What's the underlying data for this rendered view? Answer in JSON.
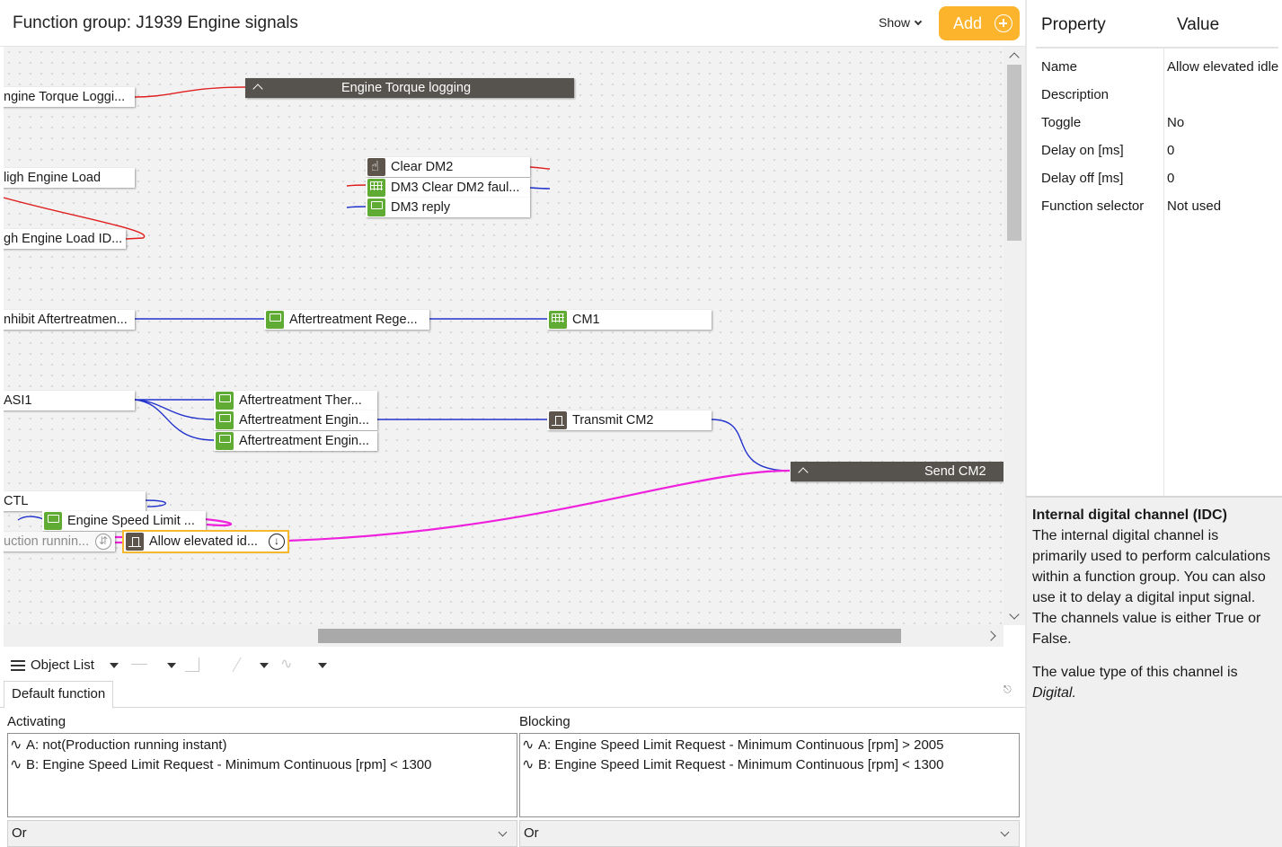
{
  "header": {
    "title": "Function group: J1939 Engine signals",
    "show_label": "Show",
    "add_label": "Add"
  },
  "canvas": {
    "groups": {
      "engine_torque": "Engine Torque logging",
      "send_cm2": "Send CM2"
    },
    "nodes": {
      "engine_torque_logging": "ngine Torque Loggi...",
      "high_engine_load": "ligh Engine Load",
      "high_engine_load_id": "gh Engine Load ID...",
      "clear_dm2": "Clear DM2",
      "dm3_clear_dm2_faul": "DM3 Clear DM2 faul...",
      "dm3_reply": "DM3 reply",
      "inhibit_aftertreatment": "nhibit Aftertreatmen...",
      "aftertreatment_rege": "Aftertreatment Rege...",
      "cm1": "CM1",
      "asi1": "ASI1",
      "aftertreatment_ther": "Aftertreatment Ther...",
      "aftertreatment_engin_1": "Aftertreatment Engin...",
      "aftertreatment_engin_2": "Aftertreatment Engin...",
      "transmit_cm2": "Transmit CM2",
      "ctl": "CTL",
      "engine_speed_limit": "Engine Speed Limit ...",
      "production_running": "uction runnin...",
      "allow_elevated_id": "Allow elevated id..."
    }
  },
  "toolbar": {
    "object_list_label": "Object List"
  },
  "function_tabs": {
    "default_label": "Default function"
  },
  "activating": {
    "label": "Activating",
    "conditions": [
      "A: not(Production running instant)",
      "B: Engine Speed Limit Request - Minimum Continuous [rpm] < 1300"
    ],
    "operator": "Or"
  },
  "blocking": {
    "label": "Blocking",
    "conditions": [
      "A: Engine Speed Limit Request - Minimum Continuous [rpm] > 2005",
      "B: Engine Speed Limit Request - Minimum Continuous [rpm] < 1300"
    ],
    "operator": "Or"
  },
  "properties": {
    "header_property": "Property",
    "header_value": "Value",
    "rows": [
      {
        "key": "Name",
        "value": "Allow elevated idle"
      },
      {
        "key": "Description",
        "value": ""
      },
      {
        "key": "Toggle",
        "value": "No"
      },
      {
        "key": "Delay on [ms]",
        "value": "0"
      },
      {
        "key": "Delay off [ms]",
        "value": "0"
      },
      {
        "key": "Function selector",
        "value": "Not used"
      }
    ]
  },
  "help": {
    "title": "Internal digital channel (IDC)",
    "body": "The internal digital channel is primarily used to perform calculations within a function group. You can also use it to delay a digital input signal. The channels value is either True or False.",
    "value_type_prefix": "The value type of this channel is",
    "value_type": "Digital."
  },
  "colors": {
    "accent": "#fbb42c",
    "wire_blue": "#2233cc",
    "wire_red": "#e02020",
    "wire_magenta": "#ee22dd",
    "node_green": "#5fab34",
    "node_brown": "#5d544c"
  }
}
